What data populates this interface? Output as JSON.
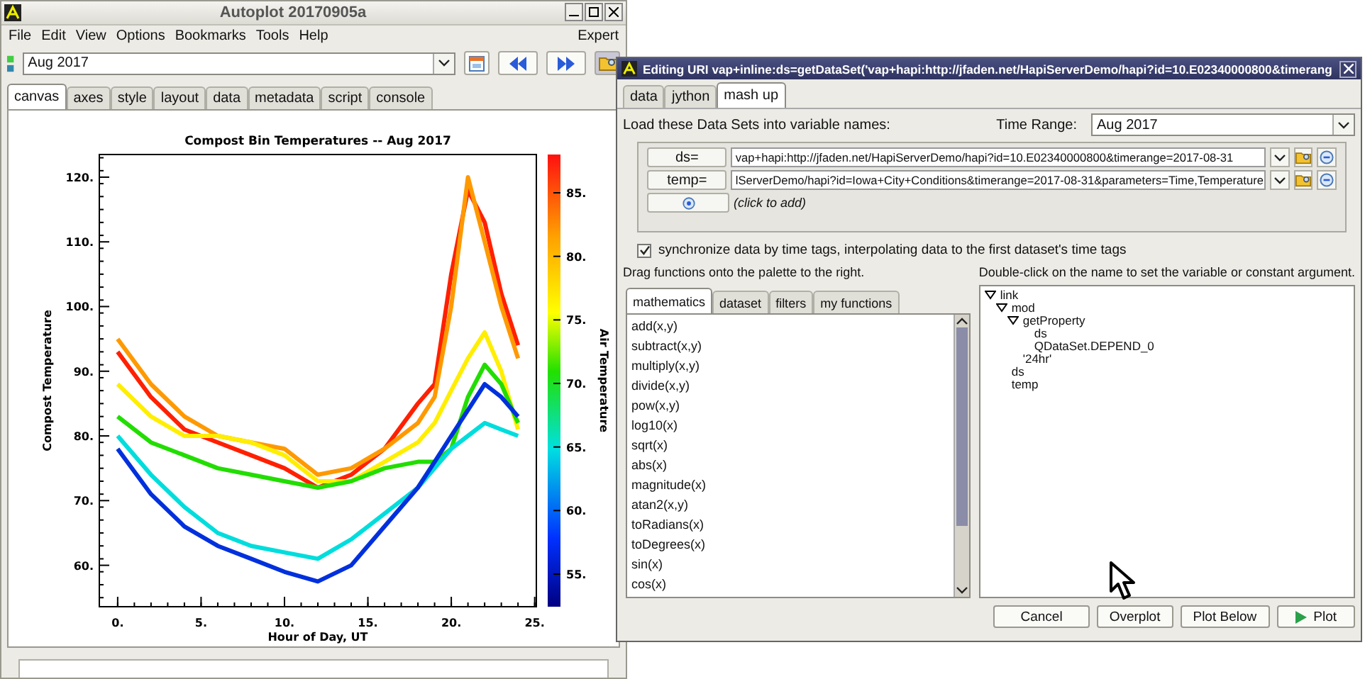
{
  "main_window": {
    "title": "Autoplot 20170905a",
    "menu": [
      "File",
      "Edit",
      "View",
      "Options",
      "Bookmarks",
      "Tools",
      "Help"
    ],
    "mode": "Expert",
    "uri_field": {
      "value": "Aug 2017"
    },
    "tabs": [
      {
        "label": "canvas",
        "selected": true
      },
      {
        "label": "axes",
        "selected": false
      },
      {
        "label": "style",
        "selected": false
      },
      {
        "label": "layout",
        "selected": false
      },
      {
        "label": "data",
        "selected": false
      },
      {
        "label": "metadata",
        "selected": false
      },
      {
        "label": "script",
        "selected": false
      },
      {
        "label": "console",
        "selected": false
      }
    ],
    "plot": {
      "chart_data": {
        "type": "line",
        "title": "Compost Bin Temperatures -- Aug 2017",
        "xlabel": "Hour of Day, UT",
        "ylabel": "Compost Temperature",
        "x": [
          0,
          2,
          4,
          6,
          8,
          10,
          12,
          14,
          16,
          18,
          19,
          20,
          21,
          22,
          23,
          24
        ],
        "series": [
          {
            "color": "#ff2000",
            "values": [
              93,
              86,
              81,
              79,
              77,
              75,
              72,
              74,
              78,
              85,
              88,
              105,
              118,
              113,
              102,
              94
            ]
          },
          {
            "color": "#ff9900",
            "values": [
              95,
              88,
              83,
              80,
              79,
              78,
              74,
              75,
              78,
              82,
              86,
              100,
              120,
              110,
              100,
              92
            ]
          },
          {
            "color": "#ffee00",
            "values": [
              88,
              83,
              80,
              80,
              79,
              77,
              73,
              73,
              76,
              79,
              82,
              87,
              92,
              96,
              90,
              81
            ]
          },
          {
            "color": "#22dd00",
            "values": [
              83,
              79,
              77,
              75,
              74,
              73,
              72,
              73,
              75,
              76,
              76,
              78,
              86,
              91,
              88,
              82
            ]
          },
          {
            "color": "#00dddd",
            "values": [
              80,
              74,
              69,
              65,
              63,
              62,
              61,
              64,
              68,
              72,
              75,
              78,
              80,
              82,
              81,
              80
            ]
          },
          {
            "color": "#0030dd",
            "values": [
              78,
              71,
              66,
              63,
              61,
              59,
              57.5,
              60,
              66,
              72,
              76,
              80,
              84,
              88,
              86,
              83
            ]
          }
        ],
        "xlim": [
          -1.1,
          25.1
        ],
        "ylim": [
          53.6,
          123.5
        ],
        "xticks": [
          {
            "value": 0,
            "label": "0."
          },
          {
            "value": 5,
            "label": "5."
          },
          {
            "value": 10,
            "label": "10."
          },
          {
            "value": 15,
            "label": "15."
          },
          {
            "value": 20,
            "label": "20."
          },
          {
            "value": 25,
            "label": "25."
          }
        ],
        "yticks": [
          {
            "value": 60,
            "label": "60."
          },
          {
            "value": 70,
            "label": "70."
          },
          {
            "value": 80,
            "label": "80."
          },
          {
            "value": 90,
            "label": "90."
          },
          {
            "value": 100,
            "label": "100."
          },
          {
            "value": 110,
            "label": "110."
          },
          {
            "value": 120,
            "label": "120."
          }
        ]
      },
      "colorbar": {
        "title": "Air Temperature",
        "ticks": [
          "85.",
          "80.",
          "75.",
          "70.",
          "65.",
          "60.",
          "55."
        ]
      }
    }
  },
  "dialog": {
    "title": "Editing URI vap+inline:ds=getDataSet('vap+hapi:http://jfaden.net/HapiServerDemo/hapi?id=10.E02340000800&timerang",
    "tabs": [
      {
        "label": "data",
        "selected": false
      },
      {
        "label": "jython",
        "selected": false
      },
      {
        "label": "mash up",
        "selected": true
      }
    ],
    "load_label": "Load these Data Sets into variable names:",
    "time_range": {
      "label": "Time Range:",
      "value": "Aug 2017"
    },
    "datasets": [
      {
        "name": "ds=",
        "uri": "vap+hapi:http://jfaden.net/HapiServerDemo/hapi?id=10.E02340000800&timerange=2017-08-31"
      },
      {
        "name": "temp=",
        "uri": "lServerDemo/hapi?id=Iowa+City+Conditions&timerange=2017-08-31&parameters=Time,Temperature"
      }
    ],
    "add_row": "(click to add)",
    "sync": {
      "label": "synchronize data by time tags, interpolating data to the first dataset's time tags",
      "checked": true
    },
    "drag_hint": "Drag functions onto the palette to the right.",
    "tree_hint": "Double-click on the name to set the variable or constant argument.",
    "function_tabs": [
      {
        "label": "mathematics",
        "selected": true
      },
      {
        "label": "dataset",
        "selected": false
      },
      {
        "label": "filters",
        "selected": false
      },
      {
        "label": "my functions",
        "selected": false
      }
    ],
    "functions": [
      "add(x,y)",
      "subtract(x,y)",
      "multiply(x,y)",
      "divide(x,y)",
      "pow(x,y)",
      "log10(x)",
      "sqrt(x)",
      "abs(x)",
      "magnitude(x)",
      "atan2(x,y)",
      "toRadians(x)",
      "toDegrees(x)",
      "sin(x)",
      "cos(x)"
    ],
    "tree": [
      {
        "label": "link",
        "expanded": true,
        "children": [
          {
            "label": "mod",
            "expanded": true,
            "children": [
              {
                "label": "getProperty",
                "expanded": true,
                "children": [
                  {
                    "label": "ds"
                  },
                  {
                    "label": "QDataSet.DEPEND_0"
                  }
                ]
              },
              {
                "label": "'24hr'"
              }
            ]
          },
          {
            "label": "ds"
          },
          {
            "label": "temp"
          }
        ]
      }
    ],
    "buttons": [
      {
        "label": "Cancel",
        "kind": "plain"
      },
      {
        "label": "Overplot",
        "kind": "plain"
      },
      {
        "label": "Plot Below",
        "kind": "plain"
      },
      {
        "label": "Plot",
        "kind": "play"
      }
    ]
  }
}
